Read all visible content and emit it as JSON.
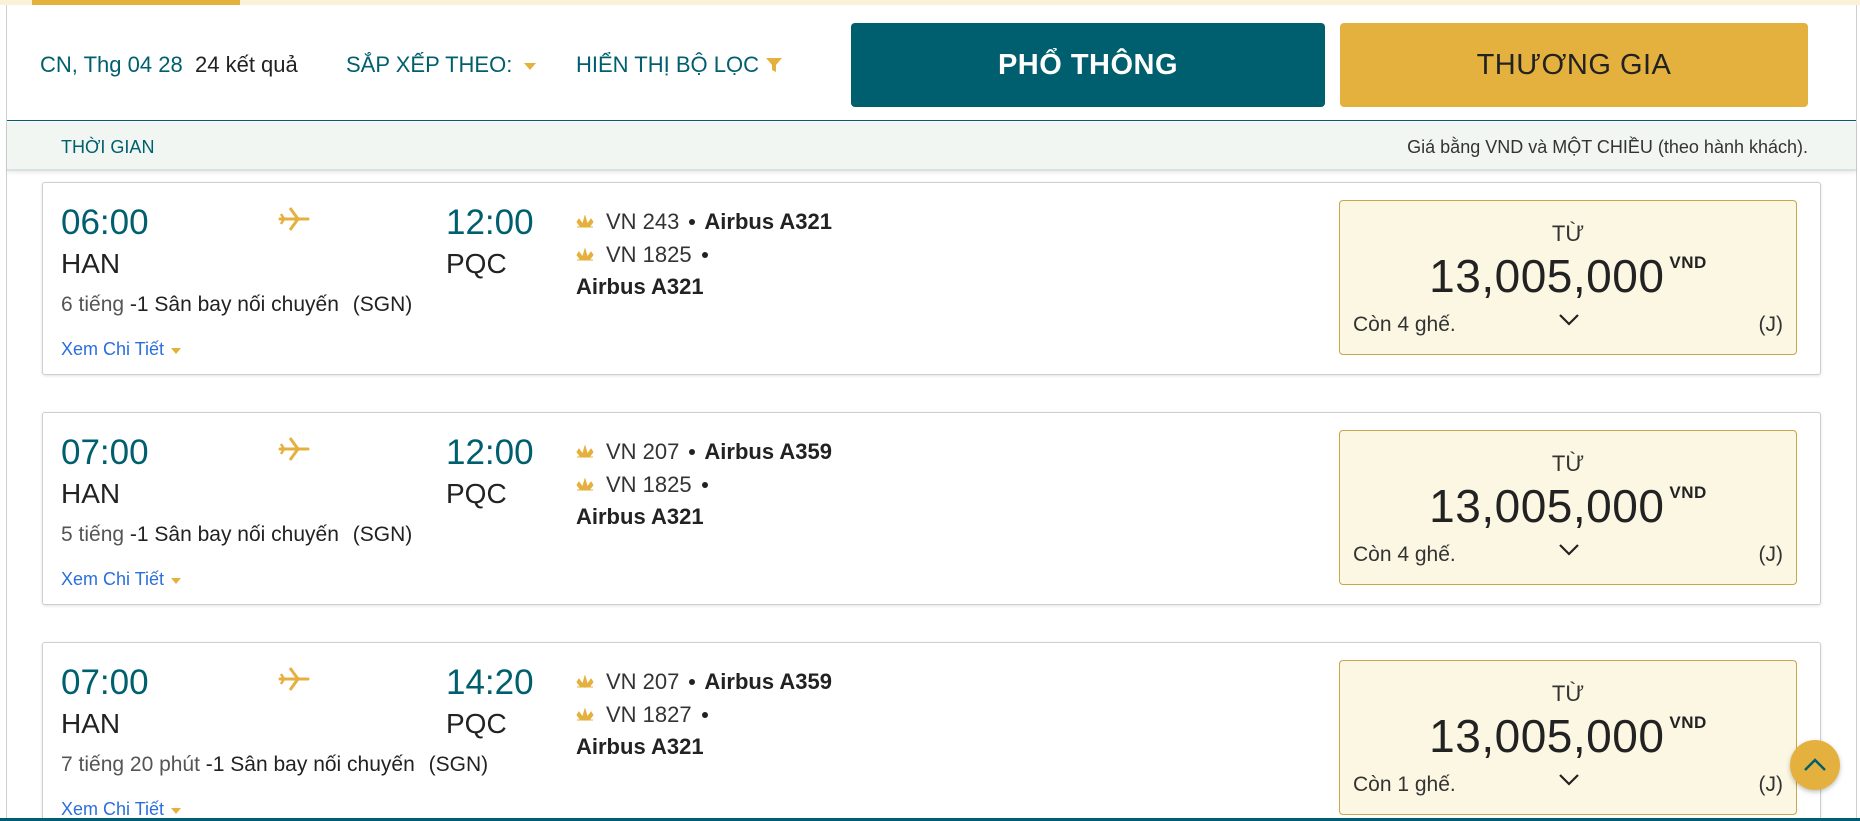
{
  "header": {
    "date": "CN, Thg 04 28",
    "result_count": "24 kết quả",
    "sort_label": "SẮP XẾP THEO:",
    "filter_label": "HIỂN THỊ BỘ LỌC",
    "economy_tab": "PHỔ THÔNG",
    "business_tab": "THƯƠNG GIA"
  },
  "subheader": {
    "left": "THỜI GIAN",
    "right": "Giá bằng VND và MỘT CHIỀU (theo hành khách)."
  },
  "flights": [
    {
      "dep_time": "06:00",
      "arr_time": "12:00",
      "dep_city": "HAN",
      "arr_city": "PQC",
      "duration": "6 tiếng",
      "stops": "-1 Sân bay nối chuyến",
      "via": "(SGN)",
      "details_link": "Xem Chi Tiết",
      "leg1_code": "VN 243",
      "leg1_aircraft": "Airbus A321",
      "leg2_code": "VN 1825",
      "leg2_aircraft": "Airbus A321",
      "price_from": "TỪ",
      "price": "13,005,000",
      "currency": "VND",
      "seats": "Còn 4 ghế.",
      "fare_class": "(J)"
    },
    {
      "dep_time": "07:00",
      "arr_time": "12:00",
      "dep_city": "HAN",
      "arr_city": "PQC",
      "duration": "5 tiếng",
      "stops": "-1 Sân bay nối chuyến",
      "via": "(SGN)",
      "details_link": "Xem Chi Tiết",
      "leg1_code": "VN 207",
      "leg1_aircraft": "Airbus A359",
      "leg2_code": "VN 1825",
      "leg2_aircraft": "Airbus A321",
      "price_from": "TỪ",
      "price": "13,005,000",
      "currency": "VND",
      "seats": "Còn 4 ghế.",
      "fare_class": "(J)"
    },
    {
      "dep_time": "07:00",
      "arr_time": "14:20",
      "dep_city": "HAN",
      "arr_city": "PQC",
      "duration": "7 tiếng 20 phút",
      "stops": "-1 Sân bay nối chuyến",
      "via": "(SGN)",
      "details_link": "Xem Chi Tiết",
      "leg1_code": "VN 207",
      "leg1_aircraft": "Airbus A359",
      "leg2_code": "VN 1827",
      "leg2_aircraft": "Airbus A321",
      "price_from": "TỪ",
      "price": "13,005,000",
      "currency": "VND",
      "seats": "Còn 1 ghế.",
      "fare_class": "(J)"
    }
  ],
  "icons": {
    "filter": "filter-icon",
    "plane": "plane-icon",
    "airline": "lotus-icon",
    "expand": "chevron-down-icon",
    "scroll_top": "chevron-up-icon"
  },
  "colors": {
    "primary": "#005f6e",
    "accent": "#e5b13e",
    "price_bg": "#fcf7e3",
    "link": "#2a6fdb"
  }
}
